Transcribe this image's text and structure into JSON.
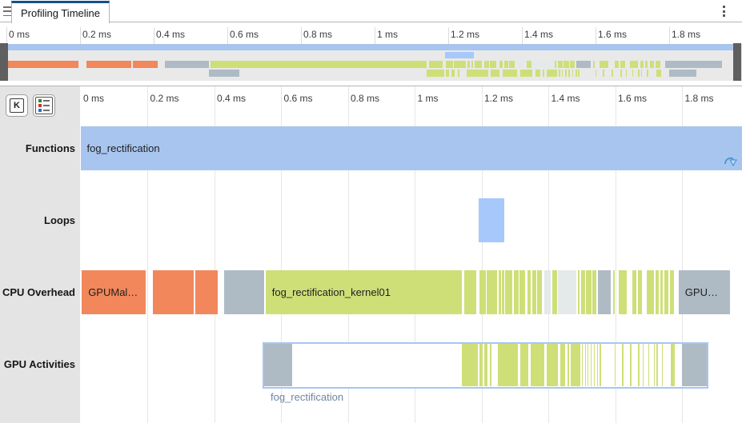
{
  "tabs": {
    "active": "Profiling Timeline"
  },
  "toolbar": {
    "kernel_label": "K"
  },
  "ruler": {
    "unit": "ms",
    "tick_interval_ms": 0.2,
    "tick_labels": [
      "0 ms",
      "0.2 ms",
      "0.4 ms",
      "0.6 ms",
      "0.8 ms",
      "1 ms",
      "1.2 ms",
      "1.4 ms",
      "1.6 ms",
      "1.8 ms"
    ]
  },
  "rows": [
    {
      "label": "Functions"
    },
    {
      "label": "Loops"
    },
    {
      "label": "CPU Overhead"
    },
    {
      "label": "GPU Activities"
    }
  ],
  "palette": {
    "function": "#a8c5ef",
    "loop": "#a6c8fb",
    "overhead": "#f1875b",
    "kernel": "#cedf78",
    "memory": "#aebbc4",
    "other": "#e4e9ea",
    "selection_border": "#a8c6f1",
    "tab_accent": "#174e87"
  },
  "tracks": {
    "functions": {
      "segments": [
        {
          "s": 0,
          "e": 1.981,
          "c": "function",
          "label": "fog_rectification"
        }
      ]
    },
    "loops": {
      "segments": [
        {
          "s": 1.192,
          "e": 1.269,
          "c": "loop"
        }
      ]
    },
    "cpu_overhead": {
      "segments": [
        {
          "s": 0.004,
          "e": 0.195,
          "c": "overhead",
          "label": "GPUMal…"
        },
        {
          "s": 0.217,
          "e": 0.339,
          "c": "overhead"
        },
        {
          "s": 0.344,
          "e": 0.411,
          "c": "overhead"
        },
        {
          "s": 0.43,
          "e": 0.55,
          "c": "memory"
        },
        {
          "s": 0.554,
          "e": 1.141,
          "c": "kernel",
          "label": "fog_rectification_kernel01"
        },
        {
          "s": 1.148,
          "e": 1.184,
          "c": "kernel"
        },
        {
          "s": 1.194,
          "e": 1.213,
          "c": "kernel"
        },
        {
          "s": 1.215,
          "e": 1.247,
          "c": "kernel"
        },
        {
          "s": 1.251,
          "e": 1.258,
          "c": "kernel"
        },
        {
          "s": 1.262,
          "e": 1.268,
          "c": "kernel"
        },
        {
          "s": 1.271,
          "e": 1.292,
          "c": "kernel"
        },
        {
          "s": 1.297,
          "e": 1.311,
          "c": "kernel"
        },
        {
          "s": 1.314,
          "e": 1.33,
          "c": "kernel"
        },
        {
          "s": 1.338,
          "e": 1.347,
          "c": "kernel"
        },
        {
          "s": 1.352,
          "e": 1.364,
          "c": "kernel"
        },
        {
          "s": 1.366,
          "e": 1.381,
          "c": "kernel"
        },
        {
          "s": 1.388,
          "e": 1.407,
          "c": "other"
        },
        {
          "s": 1.412,
          "e": 1.426,
          "c": "kernel"
        },
        {
          "s": 1.429,
          "e": 1.484,
          "c": "other"
        },
        {
          "s": 1.488,
          "e": 1.493,
          "c": "kernel"
        },
        {
          "s": 1.498,
          "e": 1.51,
          "c": "kernel"
        },
        {
          "s": 1.512,
          "e": 1.529,
          "c": "kernel"
        },
        {
          "s": 1.531,
          "e": 1.543,
          "c": "kernel"
        },
        {
          "s": 1.548,
          "e": 1.587,
          "c": "memory"
        },
        {
          "s": 1.594,
          "e": 1.599,
          "c": "kernel"
        },
        {
          "s": 1.61,
          "e": 1.634,
          "c": "kernel"
        },
        {
          "s": 1.651,
          "e": 1.663,
          "c": "kernel"
        },
        {
          "s": 1.668,
          "e": 1.68,
          "c": "kernel"
        },
        {
          "s": 1.694,
          "e": 1.716,
          "c": "kernel"
        },
        {
          "s": 1.721,
          "e": 1.73,
          "c": "kernel"
        },
        {
          "s": 1.735,
          "e": 1.742,
          "c": "kernel"
        },
        {
          "s": 1.747,
          "e": 1.759,
          "c": "kernel"
        },
        {
          "s": 1.764,
          "e": 1.776,
          "c": "kernel"
        },
        {
          "s": 1.79,
          "e": 1.944,
          "c": "memory",
          "label": "GPU…"
        }
      ]
    },
    "gpu_activities": {
      "selection": {
        "s": 0.545,
        "e": 1.879,
        "label": "fog_rectification"
      },
      "segments": [
        {
          "s": 0.55,
          "e": 0.633,
          "c": "memory"
        },
        {
          "s": 1.141,
          "e": 1.189,
          "c": "kernel"
        },
        {
          "s": 1.194,
          "e": 1.203,
          "c": "kernel"
        },
        {
          "s": 1.208,
          "e": 1.218,
          "c": "kernel"
        },
        {
          "s": 1.225,
          "e": 1.23,
          "c": "kernel"
        },
        {
          "s": 1.249,
          "e": 1.309,
          "c": "kernel"
        },
        {
          "s": 1.316,
          "e": 1.34,
          "c": "kernel"
        },
        {
          "s": 1.347,
          "e": 1.388,
          "c": "kernel"
        },
        {
          "s": 1.395,
          "e": 1.429,
          "c": "kernel"
        },
        {
          "s": 1.436,
          "e": 1.45,
          "c": "kernel"
        },
        {
          "s": 1.457,
          "e": 1.462,
          "c": "kernel"
        },
        {
          "s": 1.467,
          "e": 1.496,
          "c": "kernel"
        },
        {
          "s": 1.5,
          "e": 1.504,
          "c": "kernel"
        },
        {
          "s": 1.509,
          "e": 1.512,
          "c": "kernel"
        },
        {
          "s": 1.517,
          "e": 1.521,
          "c": "kernel"
        },
        {
          "s": 1.527,
          "e": 1.53,
          "c": "kernel"
        },
        {
          "s": 1.536,
          "e": 1.54,
          "c": "kernel"
        },
        {
          "s": 1.546,
          "e": 1.549,
          "c": "kernel"
        },
        {
          "s": 1.553,
          "e": 1.557,
          "c": "kernel"
        },
        {
          "s": 1.599,
          "e": 1.602,
          "c": "kernel"
        },
        {
          "s": 1.62,
          "e": 1.624,
          "c": "kernel"
        },
        {
          "s": 1.644,
          "e": 1.648,
          "c": "kernel"
        },
        {
          "s": 1.668,
          "e": 1.672,
          "c": "kernel"
        },
        {
          "s": 1.682,
          "e": 1.686,
          "c": "kernel"
        },
        {
          "s": 1.699,
          "e": 1.703,
          "c": "kernel"
        },
        {
          "s": 1.716,
          "e": 1.719,
          "c": "kernel"
        },
        {
          "s": 1.723,
          "e": 1.727,
          "c": "kernel"
        },
        {
          "s": 1.74,
          "e": 1.743,
          "c": "kernel"
        },
        {
          "s": 1.766,
          "e": 1.778,
          "c": "kernel"
        },
        {
          "s": 1.8,
          "e": 1.874,
          "c": "memory"
        }
      ]
    }
  }
}
